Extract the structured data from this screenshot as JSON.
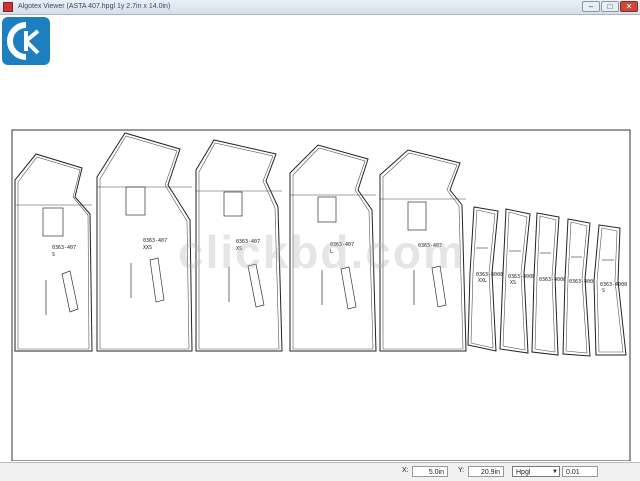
{
  "window": {
    "title": "Algotex Viewer (ASTA 407.hpgl 1y 2.7in x 14.0in)",
    "buttons": {
      "minimize": "–",
      "maximize": "□",
      "close": "✕"
    }
  },
  "pieces": [
    {
      "code": "0363-407",
      "size": "S"
    },
    {
      "code": "0363-407",
      "size": "XXS"
    },
    {
      "code": "0363-407",
      "size": "XS"
    },
    {
      "code": "0363-407",
      "size": "L"
    },
    {
      "code": "0363-407",
      "size": ""
    },
    {
      "code": "0363-4008",
      "size": "XXL"
    },
    {
      "code": "0363-4008",
      "size": "XS"
    },
    {
      "code": "0363-4008",
      "size": ""
    },
    {
      "code": "0363-4008",
      "size": ""
    },
    {
      "code": "0363-4008",
      "size": "S"
    }
  ],
  "status": {
    "x_label": "X:",
    "x_value": "5.0in",
    "y_label": "Y:",
    "y_value": "20.9in",
    "format_select": "Hpgl",
    "scale_value": "0.01"
  },
  "watermark": "clickbd.com",
  "colors": {
    "titlebar": "#d5dfea",
    "accent": "#1e7fc0"
  }
}
